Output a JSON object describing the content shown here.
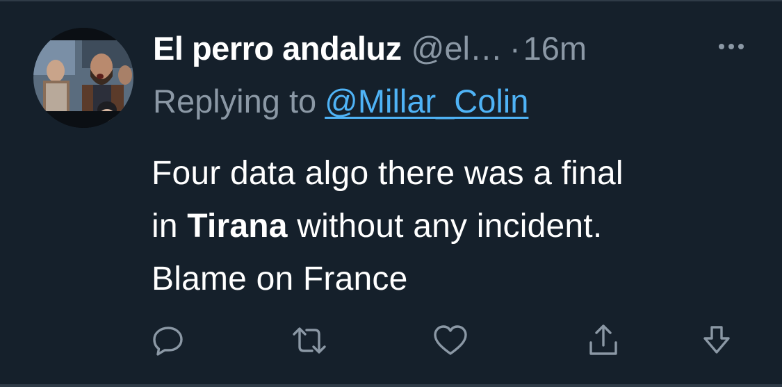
{
  "tweet": {
    "author_name": "El perro andaluz",
    "author_handle": "@el…",
    "separator": "·",
    "timestamp": "16m",
    "replying_to_prefix": "Replying to",
    "replying_to_handle": "@Millar_Colin",
    "text_lines": [
      {
        "before": "Four data algo there was a final",
        "bold": "",
        "after": ""
      },
      {
        "before": "in ",
        "bold": "Tirana",
        "after": " without any incident."
      },
      {
        "before": "Blame on France",
        "bold": "",
        "after": ""
      }
    ]
  },
  "icons": {
    "more": "more-horizontal-icon",
    "reply": "reply-bubble-icon",
    "retweet": "retweet-icon",
    "like": "heart-icon",
    "share": "share-upload-icon",
    "download": "download-arrow-icon"
  },
  "colors": {
    "background": "#15202b",
    "primary_text": "#ffffff",
    "secondary_text": "#8b98a5",
    "link": "#4fb3f6"
  }
}
